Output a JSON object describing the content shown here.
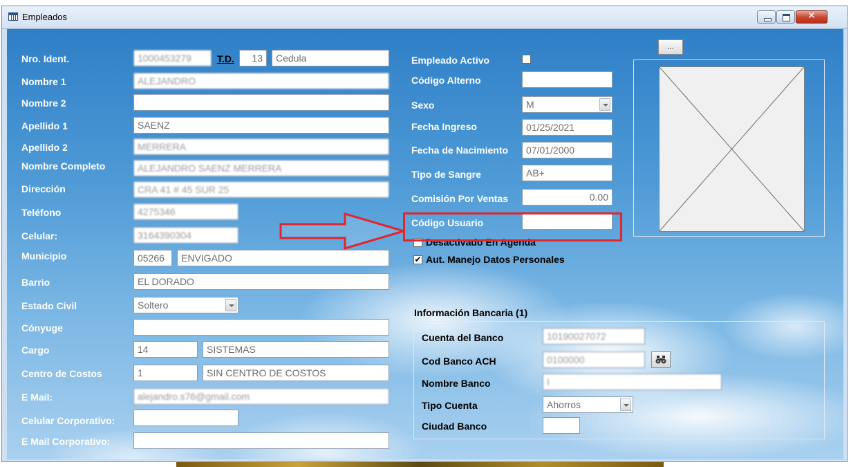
{
  "window": {
    "title": "Empleados",
    "close_glyph": "✕"
  },
  "photo_button_label": "...",
  "left": {
    "nro_ident": {
      "label": "Nro. Ident.",
      "value": "1000453279"
    },
    "td": {
      "label": "T.D.",
      "code": "13",
      "desc": "Cedula"
    },
    "nombre1": {
      "label": "Nombre 1",
      "value": "ALEJANDRO"
    },
    "nombre2": {
      "label": "Nombre 2",
      "value": ""
    },
    "apellido1": {
      "label": "Apellido 1",
      "value": "SAENZ"
    },
    "apellido2": {
      "label": "Apellido 2",
      "value": "MERRERA"
    },
    "nombre_completo": {
      "label": "Nombre Completo",
      "value": "ALEJANDRO SAENZ MERRERA"
    },
    "direccion": {
      "label": "Dirección",
      "value": "CRA 41 # 45 SUR 25"
    },
    "telefono": {
      "label": "Teléfono",
      "value": "4275346"
    },
    "celular": {
      "label": "Celular:",
      "value": "3164390304"
    },
    "municipio": {
      "label": "Municipio",
      "code": "05266",
      "name": "ENVIGADO"
    },
    "barrio": {
      "label": "Barrio",
      "value": "EL DORADO"
    },
    "estado_civil": {
      "label": "Estado Civil",
      "value": "Soltero"
    },
    "conyuge": {
      "label": "Cónyuge",
      "value": ""
    },
    "cargo": {
      "label": "Cargo",
      "code": "14",
      "name": "SISTEMAS"
    },
    "centro_costos": {
      "label": "Centro de Costos",
      "code": "1",
      "name": "SIN CENTRO DE COSTOS"
    },
    "email": {
      "label": "E Mail:",
      "value": "alejandro.s76@gmail.com"
    },
    "celular_corp": {
      "label": "Celular Corporativo:",
      "value": ""
    },
    "email_corp": {
      "label": "E Mail Corporativo:",
      "value": ""
    }
  },
  "right": {
    "empleado_activo": {
      "label": "Empleado Activo",
      "checked": false
    },
    "codigo_alterno": {
      "label": "Código Alterno",
      "value": ""
    },
    "sexo": {
      "label": "Sexo",
      "value": "M"
    },
    "fecha_ingreso": {
      "label": "Fecha Ingreso",
      "value": "01/25/2021"
    },
    "fecha_nacimiento": {
      "label": "Fecha de Nacimiento",
      "value": "07/01/2000"
    },
    "tipo_sangre": {
      "label": "Tipo de Sangre",
      "value": "AB+"
    },
    "comision": {
      "label": "Comisión Por Ventas",
      "value": "0.00"
    },
    "codigo_usuario": {
      "label": "Código Usuario",
      "value": ""
    },
    "desactivado_agenda": {
      "label": "Desactivado En Agenda",
      "checked": false,
      "mark": ""
    },
    "aut_datos": {
      "label": "Aut. Manejo Datos Personales",
      "checked": true,
      "mark": "✔"
    }
  },
  "banco": {
    "title": "Información Bancaria (1)",
    "cuenta": {
      "label": "Cuenta del Banco",
      "value": "10190027072"
    },
    "cod_ach": {
      "label": "Cod Banco ACH",
      "value": "0100000"
    },
    "nombre": {
      "label": "Nombre Banco",
      "value": "I"
    },
    "tipo_cuenta": {
      "label": "Tipo Cuenta",
      "value": "Ahorros"
    },
    "ciudad": {
      "label": "Ciudad Banco",
      "value": ""
    }
  },
  "annotation": {
    "color": "#e0252b"
  }
}
